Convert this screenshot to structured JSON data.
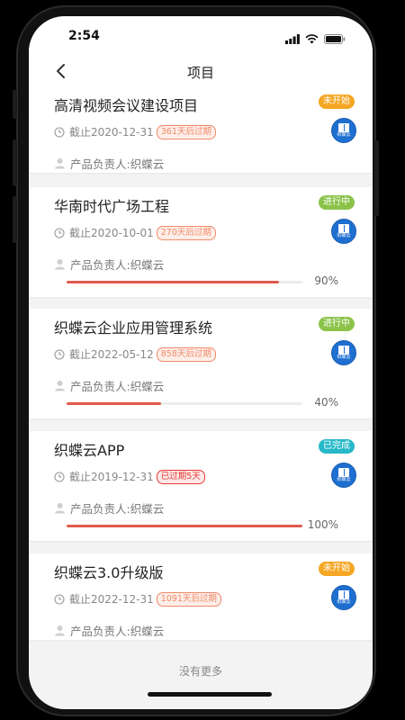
{
  "status_bar": {
    "time": "2:54"
  },
  "nav": {
    "title": "项目"
  },
  "footer": {
    "text": "没有更多"
  },
  "colors": {
    "not_started": "#f5a623",
    "in_progress": "#8bc34a",
    "completed": "#26b8c8",
    "progress_fill": "#e05a4e",
    "remaining_tag": "#f08a6a",
    "overdue_tag": "#e53935"
  },
  "projects": [
    {
      "title": "高清视频会议建设项目",
      "status": "未开始",
      "status_key": "not_started",
      "deadline": "截止2020-12-31",
      "tag": "361天后过期",
      "tag_type": "remaining",
      "owner": "产品负责人:织蝶云",
      "logo_text": "织蝶云",
      "progress": null,
      "progress_label": ""
    },
    {
      "title": "华南时代广场工程",
      "status": "进行中",
      "status_key": "in_progress",
      "deadline": "截止2020-10-01",
      "tag": "270天后过期",
      "tag_type": "remaining",
      "owner": "产品负责人:织蝶云",
      "logo_text": "织蝶云",
      "progress": 0.9,
      "progress_label": "90%"
    },
    {
      "title": "织蝶云企业应用管理系统",
      "status": "进行中",
      "status_key": "in_progress",
      "deadline": "截止2022-05-12",
      "tag": "858天后过期",
      "tag_type": "remaining",
      "owner": "产品负责人:织蝶云",
      "logo_text": "织蝶云",
      "progress": 0.4,
      "progress_label": "40%"
    },
    {
      "title": "织蝶云APP",
      "status": "已完成",
      "status_key": "completed",
      "deadline": "截止2019-12-31",
      "tag": "已过期5天",
      "tag_type": "overdue",
      "owner": "产品负责人:织蝶云",
      "logo_text": "织蝶云",
      "progress": 1.0,
      "progress_label": "100%"
    },
    {
      "title": "织蝶云3.0升级版",
      "status": "未开始",
      "status_key": "not_started",
      "deadline": "截止2022-12-31",
      "tag": "1091天后过期",
      "tag_type": "remaining",
      "owner": "产品负责人:织蝶云",
      "logo_text": "织蝶云",
      "progress": null,
      "progress_label": ""
    }
  ],
  "icons": {
    "back": "chevron-left-icon",
    "clock": "clock-icon",
    "person": "person-icon",
    "signal": "signal-icon",
    "wifi": "wifi-icon",
    "battery": "battery-icon",
    "logo": "app-logo-icon"
  }
}
